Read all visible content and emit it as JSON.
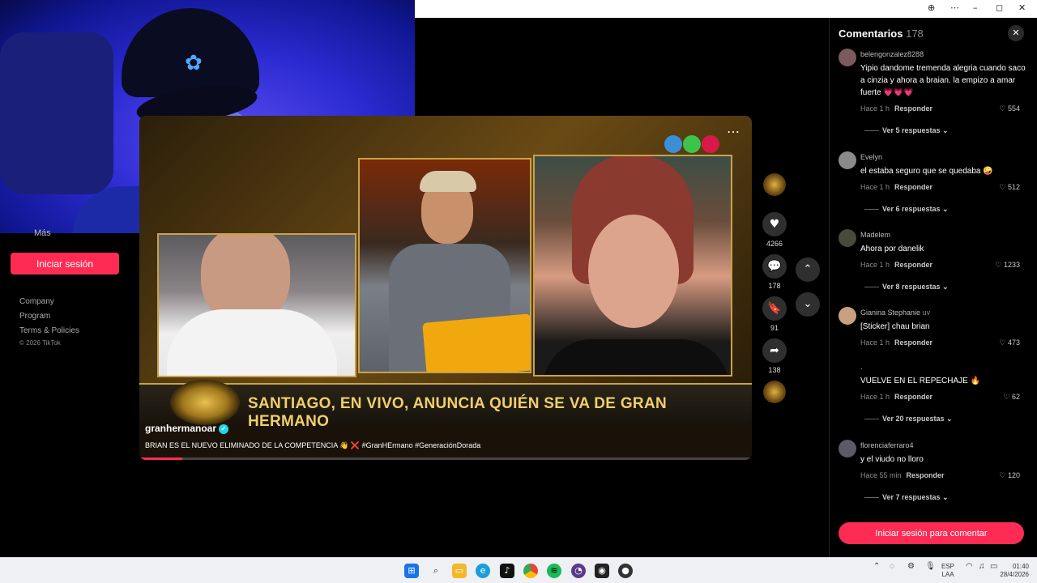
{
  "browser": {
    "controls": [
      "⊕",
      "⋯",
      "–",
      "◻",
      "✕"
    ]
  },
  "sidebar": {
    "more_label": "Más",
    "login_button": "Iniciar sesión",
    "footer_links": [
      "Company",
      "Program",
      "Terms & Policies"
    ],
    "copyright": "© 2026 TikTok"
  },
  "video": {
    "banner_text": "SANTIAGO, EN VIVO, ANUNCIA QUIÉN SE VA DE GRAN HERMANO",
    "author": "granhermanoar",
    "caption": "BRIAN ES EL NUEVO ELIMINADO DE LA COMPETENCIA 👋 ❌ #GranHErmano #GeneraciónDorada",
    "more_label": "⋯",
    "progress": 0.07,
    "logo_colors": [
      "#3a8fd8",
      "#3cc44a",
      "#d81a4a"
    ]
  },
  "actions": {
    "like_icon": "♥",
    "like_count": "4266",
    "comment_icon": "💬",
    "comment_count": "178",
    "save_icon": "🔖",
    "save_count": "91",
    "share_icon": "➦",
    "share_count": "138",
    "up_icon": "⌃",
    "down_icon": "⌄"
  },
  "comments": {
    "title": "Comentarios",
    "count": "178",
    "close_icon": "✕",
    "items": [
      {
        "user": "belengonzalez8288",
        "text": "Yipio dandome tremenda alegria cuando saco a cinzia y ahora a braian. la empizo a amar fuerte 💗💗💗",
        "time": "Hace 1 h",
        "reply": "Responder",
        "likes": "554",
        "replies": "Ver 5 respuestas ⌄"
      },
      {
        "user": "Evelyn",
        "text": "el estaba seguro que se quedaba 🤪",
        "time": "Hace 1 h",
        "reply": "Responder",
        "likes": "512",
        "replies": "Ver 6 respuestas ⌄"
      },
      {
        "user": "Madelem",
        "text": "Ahora por danelik",
        "time": "Hace 1 h",
        "reply": "Responder",
        "likes": "1233",
        "replies": "Ver 8 respuestas ⌄"
      },
      {
        "user": "Gianina Stephanie",
        "user_tag": "uv",
        "text": "[Sticker] chau brian",
        "time": "Hace 1 h",
        "reply": "Responder",
        "likes": "473",
        "replies": ""
      },
      {
        "user": ".",
        "text": "VUELVE EN EL REPECHAJE 🔥",
        "time": "Hace 1 h",
        "reply": "Responder",
        "likes": "62",
        "replies": "Ver 20 respuestas ⌄"
      },
      {
        "user": "florenciaferraro4",
        "text": "y el viudo no lloro",
        "time": "Hace 55 min",
        "reply": "Responder",
        "likes": "120",
        "replies": "Ver 7 respuestas ⌄"
      }
    ],
    "login_button": "Iniciar sesión para comentar"
  },
  "taskbar": {
    "lang_top": "ESP",
    "lang_bottom": "LAA",
    "time": "01:40",
    "date": "28/4/2026",
    "tray_up": "⌃"
  }
}
